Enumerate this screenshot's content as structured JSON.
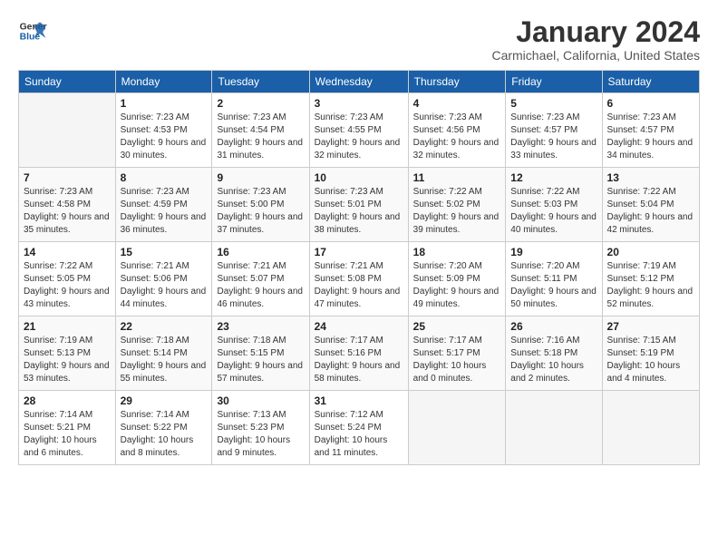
{
  "header": {
    "logo_line1": "General",
    "logo_line2": "Blue",
    "month": "January 2024",
    "location": "Carmichael, California, United States"
  },
  "days_of_week": [
    "Sunday",
    "Monday",
    "Tuesday",
    "Wednesday",
    "Thursday",
    "Friday",
    "Saturday"
  ],
  "weeks": [
    [
      {
        "day": "",
        "sunrise": "",
        "sunset": "",
        "daylight": ""
      },
      {
        "day": "1",
        "sunrise": "Sunrise: 7:23 AM",
        "sunset": "Sunset: 4:53 PM",
        "daylight": "Daylight: 9 hours and 30 minutes."
      },
      {
        "day": "2",
        "sunrise": "Sunrise: 7:23 AM",
        "sunset": "Sunset: 4:54 PM",
        "daylight": "Daylight: 9 hours and 31 minutes."
      },
      {
        "day": "3",
        "sunrise": "Sunrise: 7:23 AM",
        "sunset": "Sunset: 4:55 PM",
        "daylight": "Daylight: 9 hours and 32 minutes."
      },
      {
        "day": "4",
        "sunrise": "Sunrise: 7:23 AM",
        "sunset": "Sunset: 4:56 PM",
        "daylight": "Daylight: 9 hours and 32 minutes."
      },
      {
        "day": "5",
        "sunrise": "Sunrise: 7:23 AM",
        "sunset": "Sunset: 4:57 PM",
        "daylight": "Daylight: 9 hours and 33 minutes."
      },
      {
        "day": "6",
        "sunrise": "Sunrise: 7:23 AM",
        "sunset": "Sunset: 4:57 PM",
        "daylight": "Daylight: 9 hours and 34 minutes."
      }
    ],
    [
      {
        "day": "7",
        "sunrise": "Sunrise: 7:23 AM",
        "sunset": "Sunset: 4:58 PM",
        "daylight": "Daylight: 9 hours and 35 minutes."
      },
      {
        "day": "8",
        "sunrise": "Sunrise: 7:23 AM",
        "sunset": "Sunset: 4:59 PM",
        "daylight": "Daylight: 9 hours and 36 minutes."
      },
      {
        "day": "9",
        "sunrise": "Sunrise: 7:23 AM",
        "sunset": "Sunset: 5:00 PM",
        "daylight": "Daylight: 9 hours and 37 minutes."
      },
      {
        "day": "10",
        "sunrise": "Sunrise: 7:23 AM",
        "sunset": "Sunset: 5:01 PM",
        "daylight": "Daylight: 9 hours and 38 minutes."
      },
      {
        "day": "11",
        "sunrise": "Sunrise: 7:22 AM",
        "sunset": "Sunset: 5:02 PM",
        "daylight": "Daylight: 9 hours and 39 minutes."
      },
      {
        "day": "12",
        "sunrise": "Sunrise: 7:22 AM",
        "sunset": "Sunset: 5:03 PM",
        "daylight": "Daylight: 9 hours and 40 minutes."
      },
      {
        "day": "13",
        "sunrise": "Sunrise: 7:22 AM",
        "sunset": "Sunset: 5:04 PM",
        "daylight": "Daylight: 9 hours and 42 minutes."
      }
    ],
    [
      {
        "day": "14",
        "sunrise": "Sunrise: 7:22 AM",
        "sunset": "Sunset: 5:05 PM",
        "daylight": "Daylight: 9 hours and 43 minutes."
      },
      {
        "day": "15",
        "sunrise": "Sunrise: 7:21 AM",
        "sunset": "Sunset: 5:06 PM",
        "daylight": "Daylight: 9 hours and 44 minutes."
      },
      {
        "day": "16",
        "sunrise": "Sunrise: 7:21 AM",
        "sunset": "Sunset: 5:07 PM",
        "daylight": "Daylight: 9 hours and 46 minutes."
      },
      {
        "day": "17",
        "sunrise": "Sunrise: 7:21 AM",
        "sunset": "Sunset: 5:08 PM",
        "daylight": "Daylight: 9 hours and 47 minutes."
      },
      {
        "day": "18",
        "sunrise": "Sunrise: 7:20 AM",
        "sunset": "Sunset: 5:09 PM",
        "daylight": "Daylight: 9 hours and 49 minutes."
      },
      {
        "day": "19",
        "sunrise": "Sunrise: 7:20 AM",
        "sunset": "Sunset: 5:11 PM",
        "daylight": "Daylight: 9 hours and 50 minutes."
      },
      {
        "day": "20",
        "sunrise": "Sunrise: 7:19 AM",
        "sunset": "Sunset: 5:12 PM",
        "daylight": "Daylight: 9 hours and 52 minutes."
      }
    ],
    [
      {
        "day": "21",
        "sunrise": "Sunrise: 7:19 AM",
        "sunset": "Sunset: 5:13 PM",
        "daylight": "Daylight: 9 hours and 53 minutes."
      },
      {
        "day": "22",
        "sunrise": "Sunrise: 7:18 AM",
        "sunset": "Sunset: 5:14 PM",
        "daylight": "Daylight: 9 hours and 55 minutes."
      },
      {
        "day": "23",
        "sunrise": "Sunrise: 7:18 AM",
        "sunset": "Sunset: 5:15 PM",
        "daylight": "Daylight: 9 hours and 57 minutes."
      },
      {
        "day": "24",
        "sunrise": "Sunrise: 7:17 AM",
        "sunset": "Sunset: 5:16 PM",
        "daylight": "Daylight: 9 hours and 58 minutes."
      },
      {
        "day": "25",
        "sunrise": "Sunrise: 7:17 AM",
        "sunset": "Sunset: 5:17 PM",
        "daylight": "Daylight: 10 hours and 0 minutes."
      },
      {
        "day": "26",
        "sunrise": "Sunrise: 7:16 AM",
        "sunset": "Sunset: 5:18 PM",
        "daylight": "Daylight: 10 hours and 2 minutes."
      },
      {
        "day": "27",
        "sunrise": "Sunrise: 7:15 AM",
        "sunset": "Sunset: 5:19 PM",
        "daylight": "Daylight: 10 hours and 4 minutes."
      }
    ],
    [
      {
        "day": "28",
        "sunrise": "Sunrise: 7:14 AM",
        "sunset": "Sunset: 5:21 PM",
        "daylight": "Daylight: 10 hours and 6 minutes."
      },
      {
        "day": "29",
        "sunrise": "Sunrise: 7:14 AM",
        "sunset": "Sunset: 5:22 PM",
        "daylight": "Daylight: 10 hours and 8 minutes."
      },
      {
        "day": "30",
        "sunrise": "Sunrise: 7:13 AM",
        "sunset": "Sunset: 5:23 PM",
        "daylight": "Daylight: 10 hours and 9 minutes."
      },
      {
        "day": "31",
        "sunrise": "Sunrise: 7:12 AM",
        "sunset": "Sunset: 5:24 PM",
        "daylight": "Daylight: 10 hours and 11 minutes."
      },
      {
        "day": "",
        "sunrise": "",
        "sunset": "",
        "daylight": ""
      },
      {
        "day": "",
        "sunrise": "",
        "sunset": "",
        "daylight": ""
      },
      {
        "day": "",
        "sunrise": "",
        "sunset": "",
        "daylight": ""
      }
    ]
  ]
}
